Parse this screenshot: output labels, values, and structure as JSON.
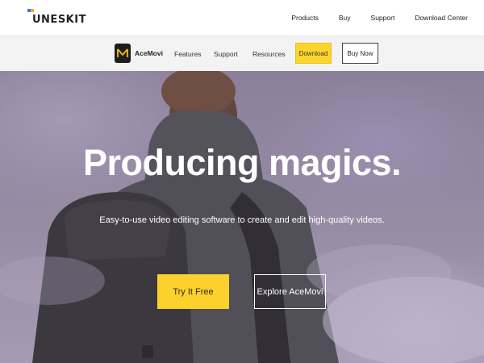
{
  "brand": {
    "name": "UNESKIT",
    "colors": {
      "blue": "#2d7cf6",
      "orange": "#f5a623"
    }
  },
  "topnav": {
    "items": [
      "Products",
      "Buy",
      "Support",
      "Download Center"
    ]
  },
  "product_bar": {
    "logo_icon": "acemovi-logo-icon",
    "name": "AceMovi",
    "nav": [
      "Features",
      "Support",
      "Resources"
    ],
    "download_label": "Download",
    "buy_label": "Buy Now",
    "accent": "#fcd52c"
  },
  "hero": {
    "title": "Producing magics.",
    "subtitle": "Easy-to-use video editing software to create and edit high-quality videos.",
    "primary_label": "Try It Free",
    "secondary_label": "Explore AceMovi",
    "accent": "#fcd12b"
  }
}
